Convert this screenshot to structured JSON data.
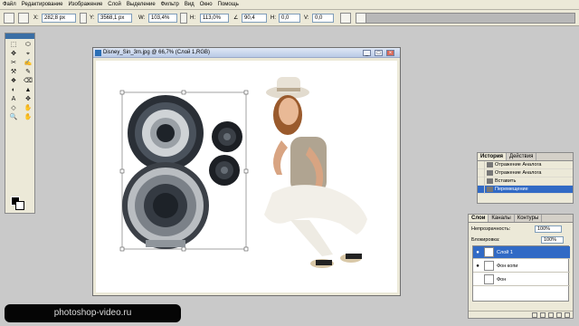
{
  "menu": [
    "Файл",
    "Редактирование",
    "Изображение",
    "Слой",
    "Выделение",
    "Фильтр",
    "Вид",
    "Окно",
    "Помощь"
  ],
  "options": {
    "x_label": "X:",
    "x_value": "282,8 px",
    "y_label": "Y:",
    "y_value": "3568,1 px",
    "w_label": "W:",
    "w_value": "103,4%",
    "h_label": "H:",
    "h_value": "113,0%",
    "angle_value": "90,4",
    "hskew_label": "H:",
    "hskew_value": "0,0",
    "vskew_label": "V:",
    "vskew_value": "0,0"
  },
  "toolbox": {
    "tools": [
      "⬚",
      "⬭",
      "✥",
      "⌖",
      "✂",
      "✍",
      "⚒",
      "✎",
      "❖",
      "⌫",
      "◐",
      "▲",
      "A",
      "✥",
      "◇",
      "✋",
      "🔍",
      "✋"
    ]
  },
  "document": {
    "title": "Disney_Sin_3m.jpg @ 66,7% (Слой 1,RGB)",
    "min": "_",
    "max": "□",
    "close": "×"
  },
  "watermark": "photoshop-video.ru",
  "history": {
    "tabs": [
      "История",
      "Действия"
    ],
    "items": [
      "Отражение Аналога",
      "Отражение Аналога",
      "Вставить",
      "Перемещение"
    ],
    "selected_index": 3
  },
  "layers": {
    "tabs": [
      "Слои",
      "Каналы",
      "Контуры"
    ],
    "opacity_label": "Непрозрачность:",
    "opacity_value": "100%",
    "lock_label": "Блокировка:",
    "fill_value": "100%",
    "items": [
      "Слой 1",
      "Фон копи",
      "Фон"
    ],
    "selected_index": 0
  },
  "colors": {
    "selection": "#316ac5",
    "workspace": "#c9c9c9",
    "panel": "#ece9d8"
  }
}
